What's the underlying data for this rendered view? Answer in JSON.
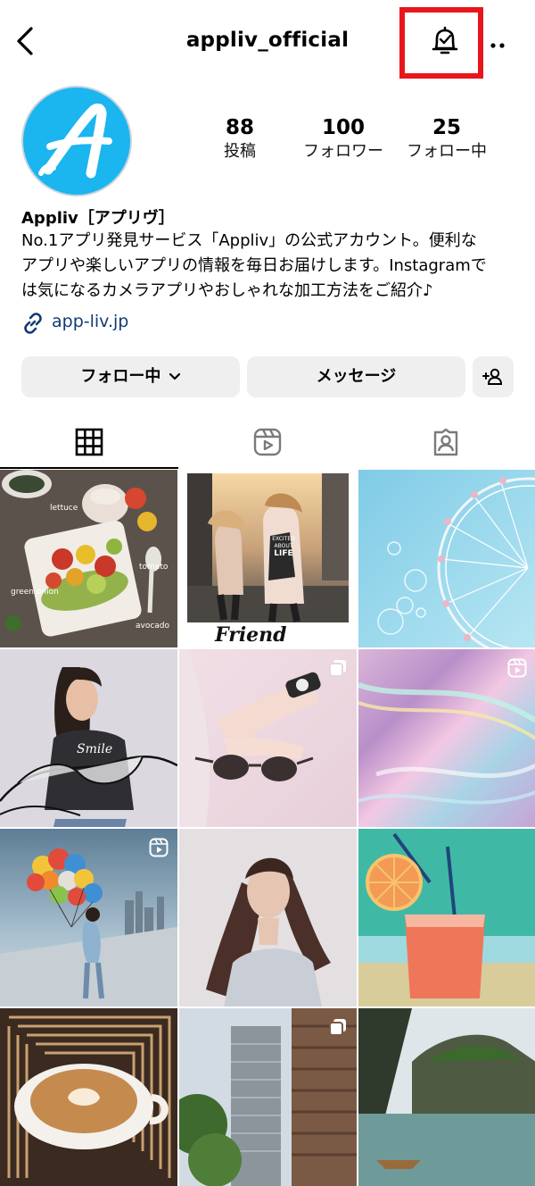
{
  "header": {
    "username": "appliv_official"
  },
  "profile": {
    "stats": [
      {
        "value": "88",
        "label": "投稿"
      },
      {
        "value": "100",
        "label": "フォロワー"
      },
      {
        "value": "25",
        "label": "フォロー中"
      }
    ],
    "display_name": "Appliv［アプリヴ］",
    "bio_lines": [
      "No.1アプリ発見サービス「Appliv」の公式アカウント。便利な",
      "アプリや楽しいアプリの情報を毎日お届けします。Instagramで",
      "は気になるカメラアプリやおしゃれな加工方法をご紹介♪"
    ],
    "link": "app-liv.jp"
  },
  "actions": {
    "following_label": "フォロー中",
    "message_label": "メッセージ"
  },
  "tabs": [
    "posts-grid",
    "reels",
    "tagged"
  ],
  "posts": {
    "food_labels": [
      "lettuce",
      "tomato",
      "green onion",
      "avocado"
    ],
    "friend_caption": "Friend",
    "shirt_text": [
      "EXCITED",
      "ABOUT",
      "LIFE"
    ],
    "smile_text": "Smile"
  },
  "colors": {
    "highlight": "#e8161b",
    "brand": "#1bb5ef",
    "link": "#123a73"
  }
}
